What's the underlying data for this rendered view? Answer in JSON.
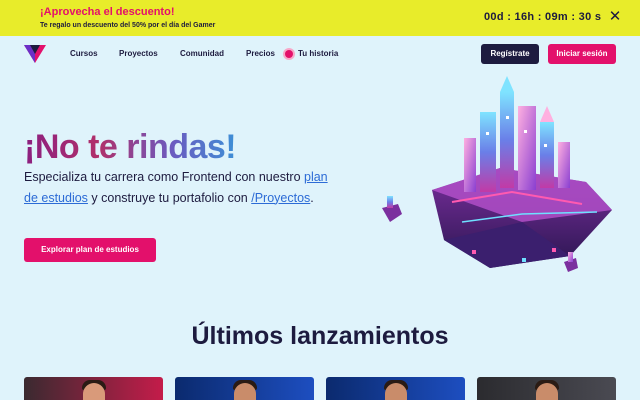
{
  "promo": {
    "title": "¡Aprovecha el descuento!",
    "subtitle": "Te regalo un descuento del 50% por el día del Gamer",
    "countdown": "00d : 16h : 09m : 30 s",
    "close_icon": "close-icon"
  },
  "nav": {
    "logo_icon": "triangle-logo-icon",
    "links": [
      "Cursos",
      "Proyectos",
      "Comunidad",
      "Precios",
      "Tu historia"
    ],
    "register_label": "Regístrate",
    "login_label": "Iniciar sesión"
  },
  "hero": {
    "title": "¡No te rindas!",
    "text_before": "Especializa tu carrera como Frontend con nuestro ",
    "link_plan": "plan de estudios",
    "text_middle": " y construye tu portafolio con ",
    "link_projects": "/Proyectos",
    "text_after": ".",
    "cta_label": "Explorar plan de estudios",
    "art_icon": "floating-city-illustration"
  },
  "latest": {
    "title": "Últimos lanzamientos",
    "cards": [
      {
        "thumb_icon": "course-thumbnail-image"
      },
      {
        "thumb_icon": "course-thumbnail-image"
      },
      {
        "thumb_icon": "course-thumbnail-image"
      },
      {
        "thumb_icon": "course-thumbnail-image"
      }
    ]
  },
  "colors": {
    "banner_bg": "#e8ec2a",
    "accent_pink": "#e3106b",
    "navy": "#1d1b3f",
    "page_bg": "#dff3fb",
    "link_blue": "#2c6bd6"
  }
}
